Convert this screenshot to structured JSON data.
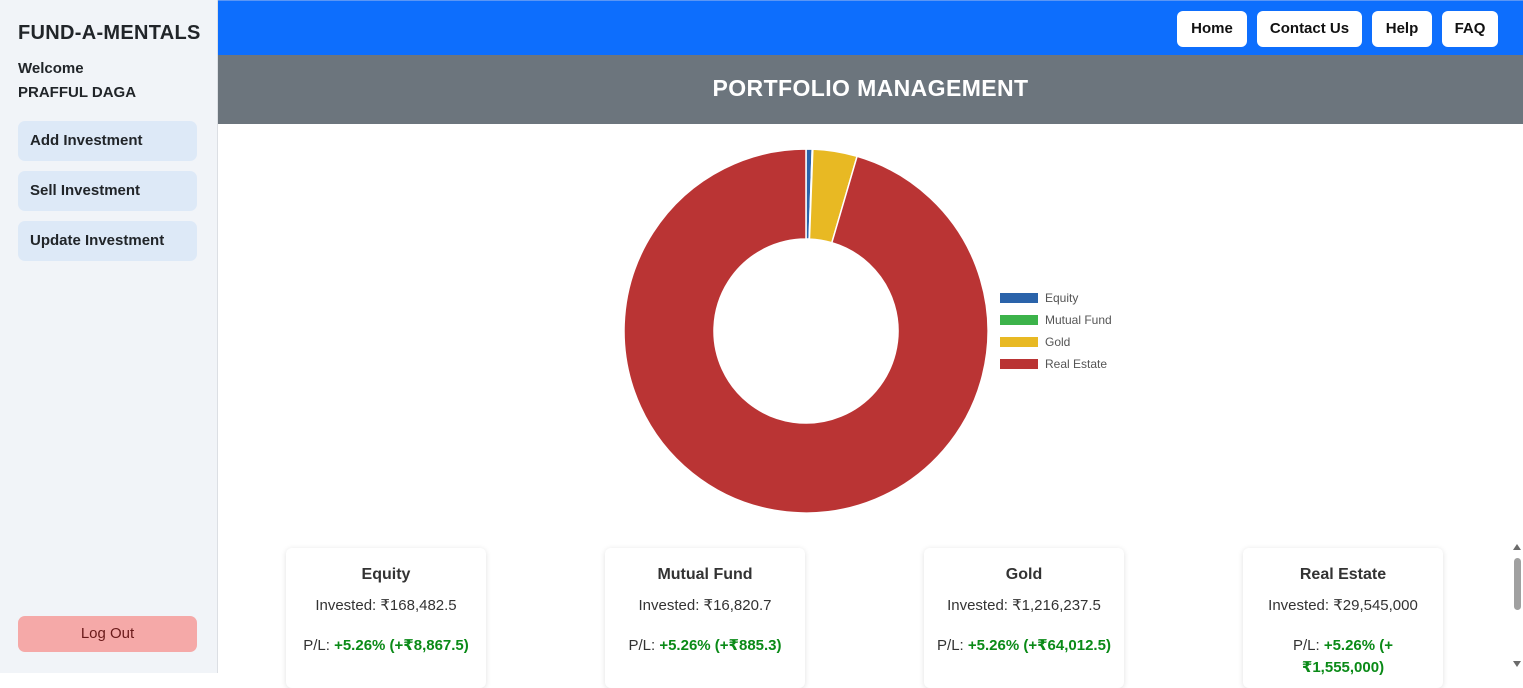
{
  "app": {
    "brand": "FUND-A-MENTALS",
    "welcome_label": "Welcome",
    "user_name": "PRAFFUL DAGA"
  },
  "sidebar": {
    "items": [
      {
        "label": "Add Investment"
      },
      {
        "label": "Sell Investment"
      },
      {
        "label": "Update Investment"
      }
    ],
    "logout_label": "Log Out"
  },
  "topnav": {
    "items": [
      {
        "label": "Home"
      },
      {
        "label": "Contact Us"
      },
      {
        "label": "Help"
      },
      {
        "label": "FAQ"
      }
    ]
  },
  "page": {
    "title": "PORTFOLIO MANAGEMENT"
  },
  "chart_data": {
    "type": "pie",
    "donut": true,
    "legend_position": "right",
    "series": [
      {
        "name": "Equity",
        "value": 168482.5,
        "color": "#2a63aa"
      },
      {
        "name": "Mutual Fund",
        "value": 16820.7,
        "color": "#3cb34a"
      },
      {
        "name": "Gold",
        "value": 1216237.5,
        "color": "#e8b923"
      },
      {
        "name": "Real Estate",
        "value": 29545000,
        "color": "#ba3434"
      }
    ]
  },
  "cards": [
    {
      "title": "Equity",
      "invested": "Invested: ₹168,482.5",
      "pl_label": "P/L:",
      "pl_value": "+5.26% (+₹8,867.5)"
    },
    {
      "title": "Mutual Fund",
      "invested": "Invested: ₹16,820.7",
      "pl_label": "P/L:",
      "pl_value": "+5.26% (+₹885.3)"
    },
    {
      "title": "Gold",
      "invested": "Invested: ₹1,216,237.5",
      "pl_label": "P/L:",
      "pl_value": "+5.26% (+₹64,012.5)"
    },
    {
      "title": "Real Estate",
      "invested": "Invested: ₹29,545,000",
      "pl_label": "P/L:",
      "pl_value": "+5.26% (+₹1,555,000)"
    }
  ],
  "colors": {
    "topbar": "#0d6efd",
    "title_band": "#6c757d",
    "sidebar": "#f1f4f8",
    "side_button": "#dde9f7",
    "logout": "#f5a9a8",
    "profit": "#0a8a17"
  }
}
